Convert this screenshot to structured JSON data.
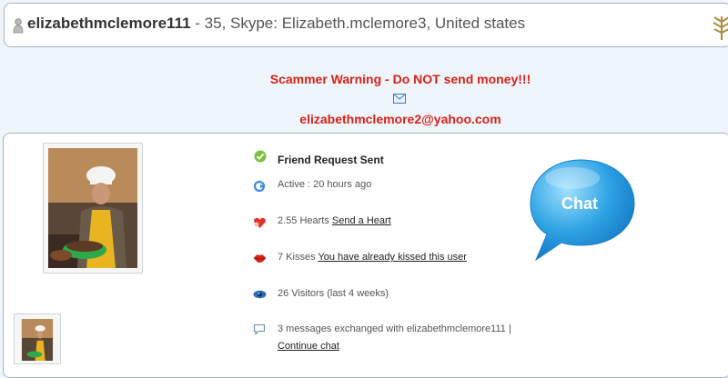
{
  "header": {
    "username": "elizabethmclemore111",
    "details": " - 35, Skype: Elizabeth.mclemore3, United states"
  },
  "warning": {
    "text": "Scammer Warning - Do NOT send money!!!",
    "email": "elizabethmclemore2@yahoo.com"
  },
  "status": {
    "friend_request": "Friend Request Sent",
    "active": "Active : 20 hours ago",
    "hearts_prefix": "2.55 Hearts ",
    "hearts_link": "Send a Heart",
    "kisses_prefix": "7 Kisses ",
    "kisses_link": "You have already kissed this user",
    "visitors": "26 Visitors (last 4 weeks)",
    "messages": "3 messages exchanged with elizabethmclemore111 |",
    "continue_chat": "Continue chat"
  },
  "chat": {
    "label": "Chat"
  },
  "colors": {
    "warning_red": "#d9221a",
    "background": "#eef6fb",
    "chat_bubble": "#2ea3e3"
  },
  "icons": [
    "user-icon",
    "logo-icon",
    "mail-icon",
    "check-icon",
    "refresh-icon",
    "heart-icon",
    "lips-icon",
    "eye-icon",
    "speech-icon"
  ]
}
